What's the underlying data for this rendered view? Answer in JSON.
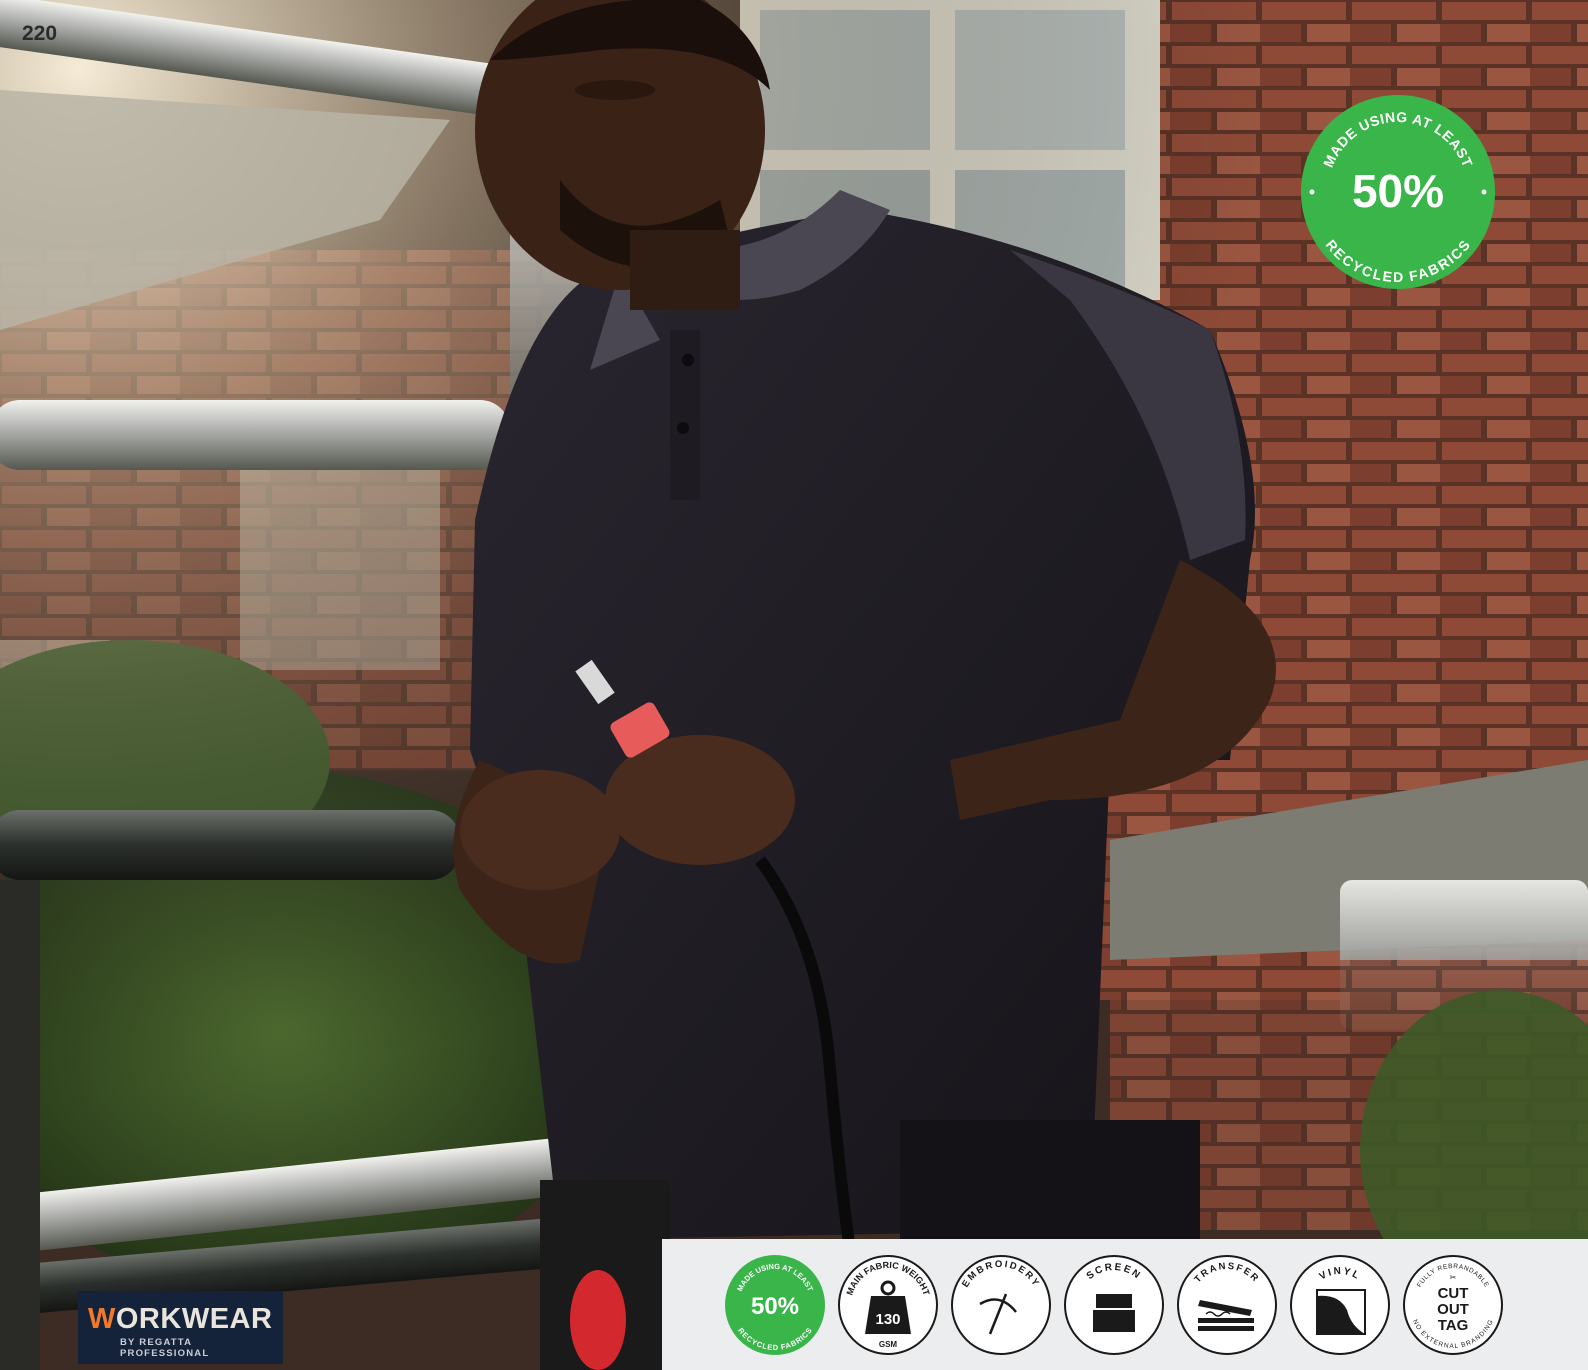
{
  "page": {
    "number": "220"
  },
  "badge": {
    "top_text": "MADE USING AT LEAST",
    "value": "50%",
    "bottom_text": "RECYCLED FABRICS",
    "color": "#3ab54a"
  },
  "logo": {
    "first_letter": "W",
    "rest": "ORKWEAR",
    "subtitle": "BY REGATTA PROFESSIONAL",
    "bg_color": "#14223a",
    "accent_color": "#f07a2c"
  },
  "icons": {
    "recycled": {
      "top_text": "MADE USING AT LEAST",
      "value": "50%",
      "bottom_text": "RECYCLED FABRICS",
      "icon": "recycled-badge-icon"
    },
    "weight": {
      "top_text": "MAIN FABRIC WEIGHT",
      "value": "130",
      "unit": "GSM",
      "icon": "weight-icon"
    },
    "embroidery": {
      "label": "EMBROIDERY",
      "icon": "needle-icon"
    },
    "screen": {
      "label": "SCREEN",
      "icon": "squeegee-icon"
    },
    "transfer": {
      "label": "TRANSFER",
      "icon": "heat-press-icon"
    },
    "vinyl": {
      "label": "VINYL",
      "icon": "vinyl-icon"
    },
    "tag": {
      "top_text": "FULLY REBRANDABLE",
      "line1": "CUT",
      "line2": "OUT",
      "line3": "TAG",
      "bottom_text": "NO EXTERNAL BRANDING",
      "icon": "scissors-icon"
    }
  }
}
